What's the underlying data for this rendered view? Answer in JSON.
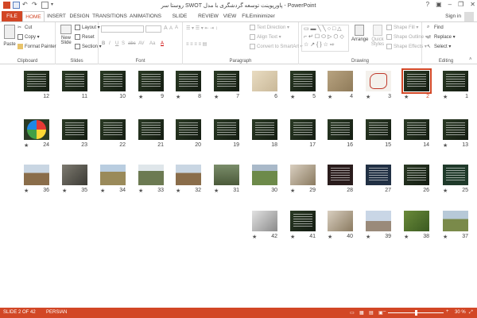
{
  "window": {
    "title": "روستا سر SWOT پاورپوینت توسعه گردشگری با مدل - PowerPoint",
    "minimize": "–",
    "restore": "❐",
    "close": "✕",
    "help": "?"
  },
  "tabs": [
    "FILE",
    "HOME",
    "INSERT",
    "DESIGN",
    "TRANSITIONS",
    "ANIMATIONS",
    "SLIDE SHOW",
    "REVIEW",
    "VIEW",
    "FILEminimizer"
  ],
  "active_tab": "HOME",
  "account": {
    "signin": "Sign in"
  },
  "ribbon": {
    "clipboard": {
      "label": "Clipboard",
      "paste": "Paste",
      "cut": "Cut",
      "copy": "Copy",
      "format_painter": "Format Painter"
    },
    "slides": {
      "label": "Slides",
      "new_slide": "New",
      "new_slide2": "Slide",
      "layout": "Layout",
      "reset": "Reset",
      "section": "Section"
    },
    "font": {
      "label": "Font",
      "bold": "B",
      "italic": "I",
      "underline": "U",
      "shadow": "S",
      "strike": "abc",
      "spacing": "AV",
      "case": "Aa",
      "color": "A",
      "grow": "A",
      "shrink": "A",
      "clear": "A"
    },
    "paragraph": {
      "label": "Paragraph",
      "text_direction": "Text Direction",
      "align_text": "Align Text",
      "convert_smartart": "Convert to SmartArt"
    },
    "drawing": {
      "label": "Drawing",
      "arrange": "Arrange",
      "quick_styles": "Quick",
      "quick_styles2": "Styles",
      "shape_fill": "Shape Fill",
      "shape_outline": "Shape Outline",
      "shape_effects": "Shape Effects"
    },
    "editing": {
      "label": "Editing",
      "find": "Find",
      "replace": "Replace",
      "select": "Select"
    }
  },
  "slides": [
    {
      "num": "1",
      "star": "★",
      "kind": "dark"
    },
    {
      "num": "2",
      "star": "★",
      "kind": "dark",
      "selected": true
    },
    {
      "num": "3",
      "star": "★",
      "kind": "map"
    },
    {
      "num": "4",
      "star": "★",
      "kind": "sand"
    },
    {
      "num": "5",
      "star": "★",
      "kind": "dark"
    },
    {
      "num": "6",
      "star": "",
      "kind": "diagram"
    },
    {
      "num": "7",
      "star": "★",
      "kind": "dark"
    },
    {
      "num": "8",
      "star": "★",
      "kind": "dark"
    },
    {
      "num": "9",
      "star": "★",
      "kind": "dark"
    },
    {
      "num": "10",
      "star": "",
      "kind": "dark"
    },
    {
      "num": "11",
      "star": "",
      "kind": "dark"
    },
    {
      "num": "12",
      "star": "",
      "kind": "dark"
    },
    {
      "num": "13",
      "star": "★",
      "kind": "dark"
    },
    {
      "num": "14",
      "star": "",
      "kind": "dark"
    },
    {
      "num": "15",
      "star": "",
      "kind": "dark"
    },
    {
      "num": "16",
      "star": "",
      "kind": "dark"
    },
    {
      "num": "17",
      "star": "",
      "kind": "dark"
    },
    {
      "num": "18",
      "star": "",
      "kind": "dark"
    },
    {
      "num": "19",
      "star": "",
      "kind": "dark"
    },
    {
      "num": "20",
      "star": "",
      "kind": "dark"
    },
    {
      "num": "21",
      "star": "",
      "kind": "dark"
    },
    {
      "num": "22",
      "star": "",
      "kind": "dark"
    },
    {
      "num": "23",
      "star": "",
      "kind": "dark"
    },
    {
      "num": "24",
      "star": "★",
      "kind": "pie"
    },
    {
      "num": "25",
      "star": "★",
      "kind": "green"
    },
    {
      "num": "26",
      "star": "",
      "kind": "dark"
    },
    {
      "num": "27",
      "star": "",
      "kind": "blue"
    },
    {
      "num": "28",
      "star": "",
      "kind": "red"
    },
    {
      "num": "29",
      "star": "★",
      "kind": "photo"
    },
    {
      "num": "30",
      "star": "",
      "kind": "field"
    },
    {
      "num": "31",
      "star": "★",
      "kind": "forest"
    },
    {
      "num": "32",
      "star": "★",
      "kind": "mountain"
    },
    {
      "num": "33",
      "star": "★",
      "kind": "trees"
    },
    {
      "num": "34",
      "star": "★",
      "kind": "valley"
    },
    {
      "num": "35",
      "star": "★",
      "kind": "rocks"
    },
    {
      "num": "36",
      "star": "★",
      "kind": "mountain"
    },
    {
      "num": "37",
      "star": "★",
      "kind": "landscape"
    },
    {
      "num": "38",
      "star": "★",
      "kind": "flower"
    },
    {
      "num": "39",
      "star": "★",
      "kind": "sky"
    },
    {
      "num": "40",
      "star": "★",
      "kind": "photo"
    },
    {
      "num": "41",
      "star": "★",
      "kind": "dark"
    },
    {
      "num": "42",
      "star": "★",
      "kind": "laptop"
    }
  ],
  "status": {
    "slide_of": "SLIDE 2 OF 42",
    "language": "PERSIAN",
    "zoom": "30 %"
  },
  "colors": {
    "accent": "#d24726",
    "dark_slide": "#1f2a1c",
    "selected_outline": "#d24726"
  }
}
